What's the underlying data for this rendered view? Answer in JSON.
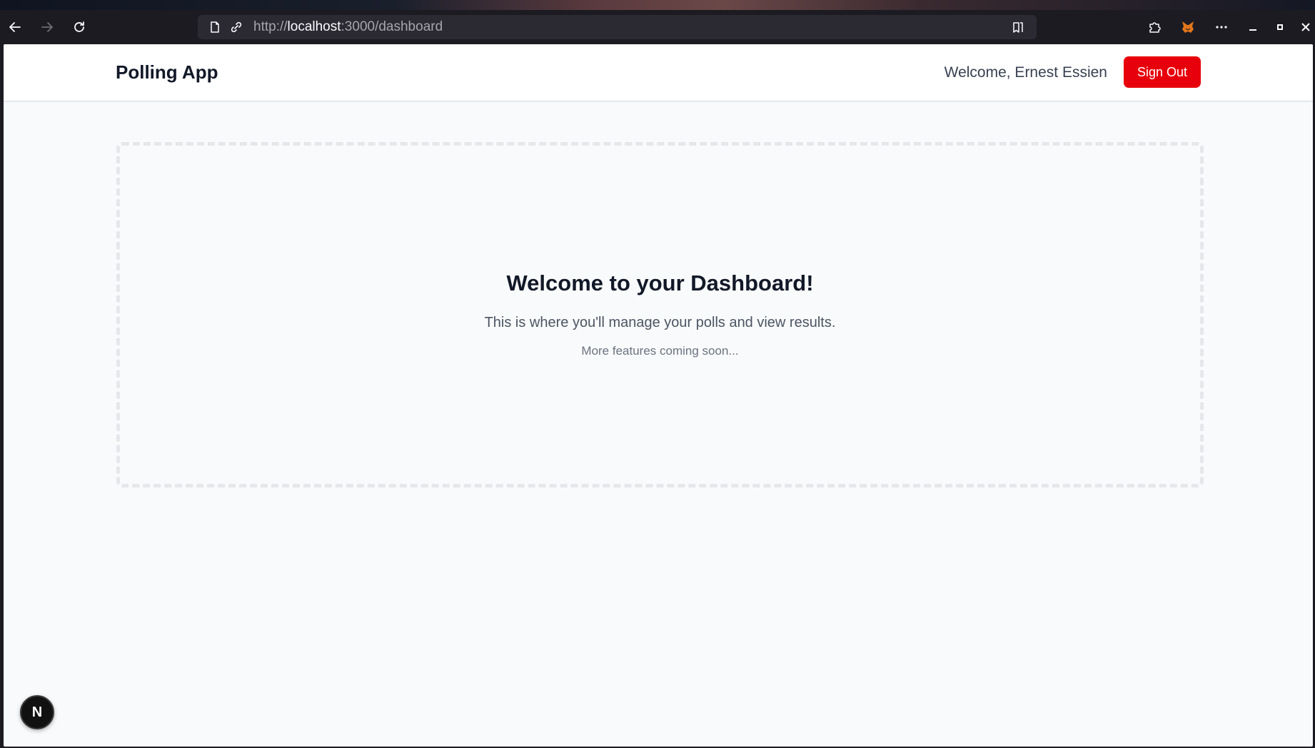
{
  "browser": {
    "url_scheme": "http://",
    "url_host": "localhost",
    "url_path": ":3000/dashboard"
  },
  "app": {
    "brand": "Polling App",
    "welcome_text": "Welcome, Ernest Essien",
    "signout_label": "Sign Out",
    "accent_color": "#e7000b"
  },
  "dashboard": {
    "title": "Welcome to your Dashboard!",
    "subtitle": "This is where you'll manage your polls and view results.",
    "note": "More features coming soon..."
  },
  "dev_badge": {
    "letter": "N"
  }
}
